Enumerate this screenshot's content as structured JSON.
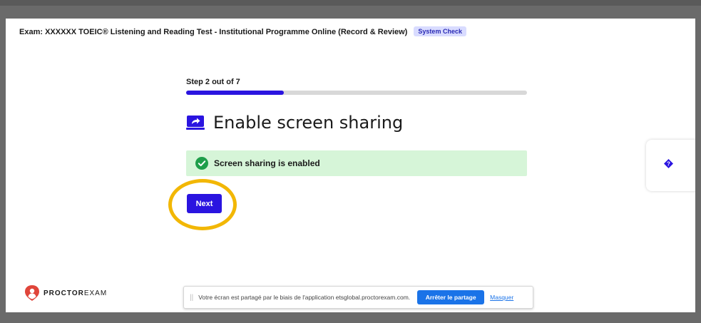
{
  "exam": {
    "title": "Exam: XXXXXX TOEIC® Listening and Reading Test - Institutional Programme Online (Record & Review)",
    "badge": "System Check"
  },
  "step": {
    "label": "Step 2 out of 7",
    "progress": 0.286
  },
  "heading": {
    "icon": "screen-share-icon",
    "text": "Enable screen sharing"
  },
  "status": {
    "icon": "check-circle-icon",
    "text": "Screen sharing is enabled"
  },
  "next_button": "Next",
  "help": {
    "icon": "question-icon"
  },
  "brand": {
    "bold": "PROCTOR",
    "light": "EXAM"
  },
  "share_bar": {
    "message": "Votre écran est partagé par le biais de l'application etsglobal.proctorexam.com.",
    "stop_label": "Arrêter le partage",
    "hide_label": "Masquer"
  },
  "colors": {
    "accent": "#2a14e0",
    "success_bg": "#d6f5d8",
    "success_icon": "#1e9e4a",
    "highlight": "#f2b705",
    "chrome_blue": "#1a73e8"
  }
}
